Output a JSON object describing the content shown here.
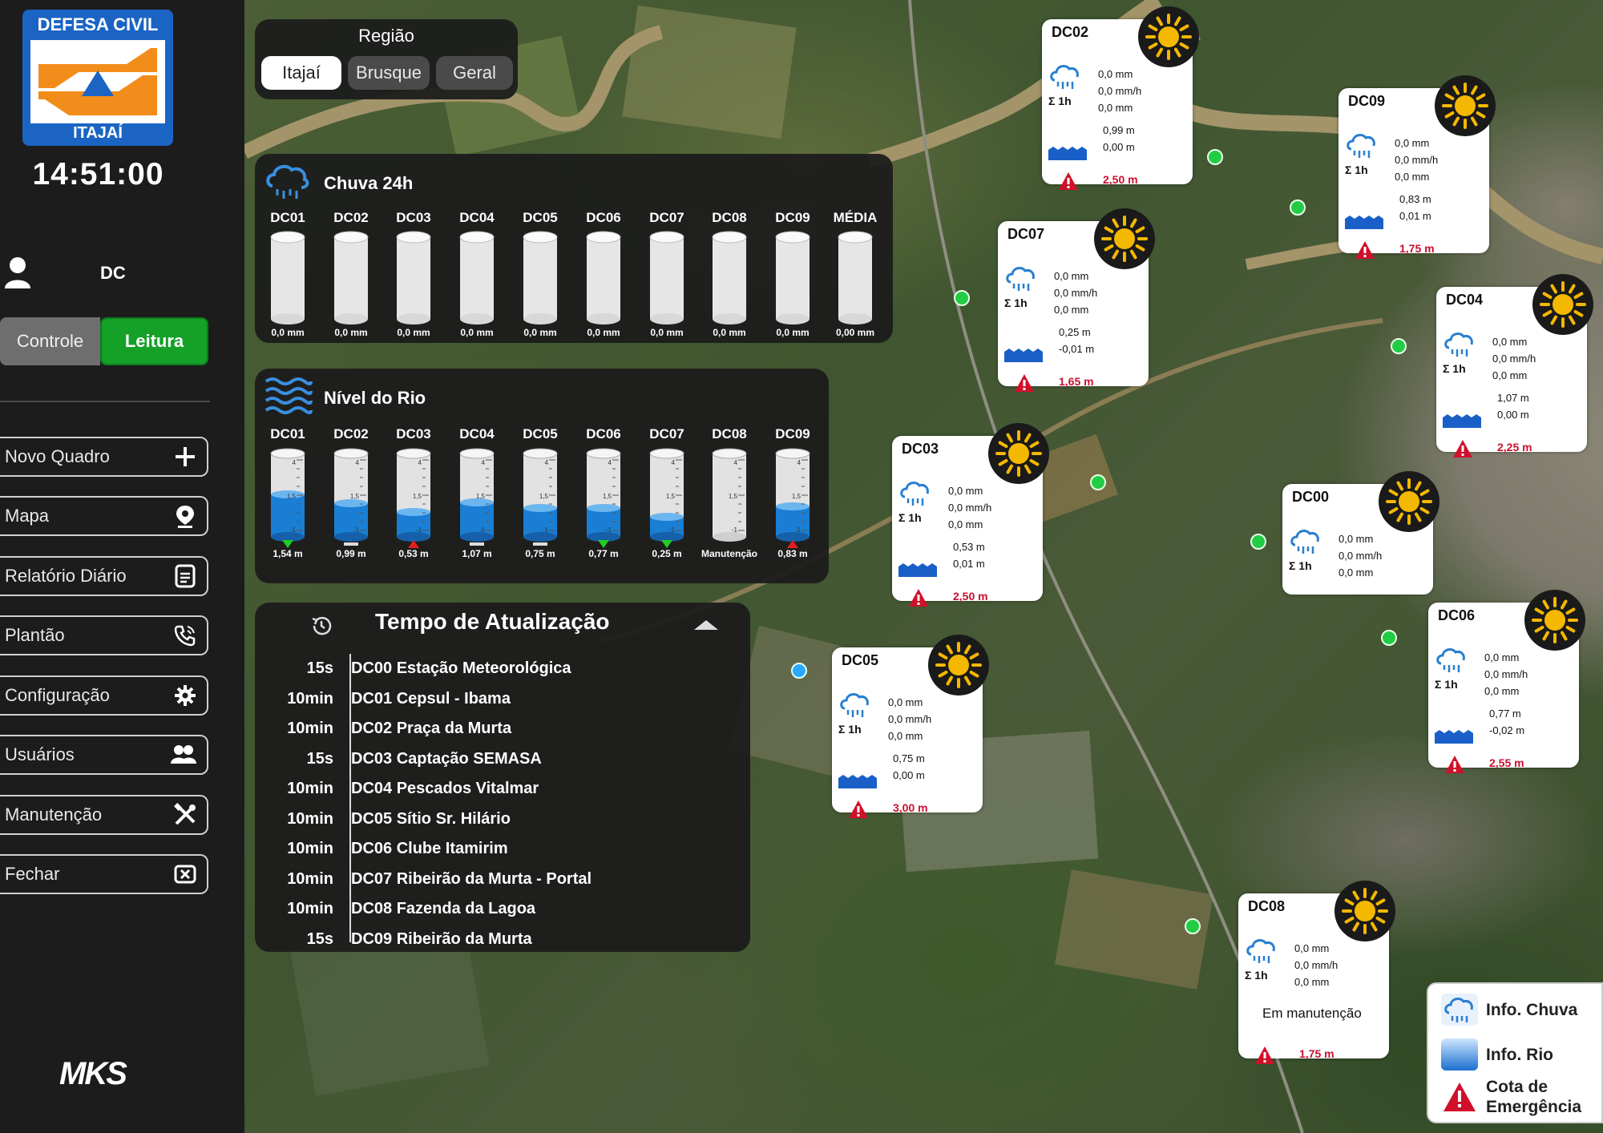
{
  "sidebar": {
    "logo_top": "DEFESA CIVIL",
    "logo_bottom": "ITAJAÍ",
    "clock": "14:51:00",
    "user": "DC",
    "mode": {
      "control": "Controle",
      "read": "Leitura"
    },
    "menu": [
      {
        "label": "Novo Quadro",
        "icon": "plus-icon"
      },
      {
        "label": "Mapa",
        "icon": "map-pin-icon"
      },
      {
        "label": "Relatório Diário",
        "icon": "report-icon"
      },
      {
        "label": "Plantão",
        "icon": "phone-icon"
      },
      {
        "label": "Configuração",
        "icon": "gear-icon"
      },
      {
        "label": "Usuários",
        "icon": "users-icon"
      },
      {
        "label": "Manutenção",
        "icon": "tools-icon"
      },
      {
        "label": "Fechar",
        "icon": "close-box-icon"
      }
    ],
    "brand": "MKS"
  },
  "region": {
    "title": "Região",
    "options": [
      "Itajaí",
      "Brusque",
      "Geral"
    ],
    "selected": "Itajaí"
  },
  "rain24h": {
    "title": "Chuva 24h",
    "stations": [
      "DC01",
      "DC02",
      "DC03",
      "DC04",
      "DC05",
      "DC06",
      "DC07",
      "DC08",
      "DC09",
      "MÉDIA"
    ],
    "values": [
      "0,0 mm",
      "0,0 mm",
      "0,0 mm",
      "0,0 mm",
      "0,0 mm",
      "0,0 mm",
      "0,0 mm",
      "0,0 mm",
      "0,0 mm",
      "0,00 mm"
    ],
    "fill": [
      0,
      0,
      0,
      0,
      0,
      0,
      0,
      0,
      0,
      0
    ]
  },
  "river": {
    "title": "Nível do Rio",
    "gauge_ticks": [
      "4",
      "1,5",
      "-1"
    ],
    "stations": [
      "DC01",
      "DC02",
      "DC03",
      "DC04",
      "DC05",
      "DC06",
      "DC07",
      "DC08",
      "DC09"
    ],
    "values": [
      "1,54 m",
      "0,99 m",
      "0,53 m",
      "1,07 m",
      "0,75 m",
      "0,77 m",
      "0,25 m",
      "Manutenção",
      "0,83 m"
    ],
    "trend": [
      "down",
      "flat",
      "up",
      "flat",
      "flat",
      "down",
      "down",
      "none",
      "up"
    ],
    "trend_colors": {
      "down": "#22cc22",
      "flat": "#dddddd",
      "up": "#e02020"
    },
    "level_fraction": [
      0.51,
      0.4,
      0.3,
      0.41,
      0.35,
      0.35,
      0.24,
      0,
      0.37
    ]
  },
  "update_times": {
    "title": "Tempo de Atualização",
    "rows": [
      {
        "t": "15s",
        "name": "DC00 Estação Meteorológica"
      },
      {
        "t": "10min",
        "name": "DC01 Cepsul - Ibama"
      },
      {
        "t": "10min",
        "name": "DC02 Praça da Murta"
      },
      {
        "t": "15s",
        "name": "DC03 Captação SEMASA"
      },
      {
        "t": "10min",
        "name": "DC04 Pescados Vitalmar"
      },
      {
        "t": "10min",
        "name": "DC05 Sítio Sr. Hilário"
      },
      {
        "t": "10min",
        "name": "DC06 Clube Itamirim"
      },
      {
        "t": "10min",
        "name": "DC07 Ribeirão da Murta - Portal"
      },
      {
        "t": "10min",
        "name": "DC08 Fazenda da Lagoa"
      },
      {
        "t": "15s",
        "name": "DC09 Ribeirão da Murta"
      }
    ]
  },
  "cards": {
    "sum_label": "Σ 1h",
    "items": [
      {
        "id": "DC02",
        "rain": [
          "0,0 mm",
          "0,0 mm/h",
          "0,0 mm"
        ],
        "level": [
          "0,99 m",
          "0,00 m"
        ],
        "emergency": "2,50 m"
      },
      {
        "id": "DC09",
        "rain": [
          "0,0 mm",
          "0,0 mm/h",
          "0,0 mm"
        ],
        "level": [
          "0,83 m",
          "0,01 m"
        ],
        "emergency": "1,75 m"
      },
      {
        "id": "DC07",
        "rain": [
          "0,0 mm",
          "0,0 mm/h",
          "0,0 mm"
        ],
        "level": [
          "0,25 m",
          "-0,01 m"
        ],
        "emergency": "1,65 m"
      },
      {
        "id": "DC04",
        "rain": [
          "0,0 mm",
          "0,0 mm/h",
          "0,0 mm"
        ],
        "level": [
          "1,07 m",
          "0,00 m"
        ],
        "emergency": "2,25 m"
      },
      {
        "id": "DC03",
        "rain": [
          "0,0 mm",
          "0,0 mm/h",
          "0,0 mm"
        ],
        "level": [
          "0,53 m",
          "0,01 m"
        ],
        "emergency": "2,50 m"
      },
      {
        "id": "DC00",
        "rain": [
          "0,0 mm",
          "0,0 mm/h",
          "0,0 mm"
        ]
      },
      {
        "id": "DC06",
        "rain": [
          "0,0 mm",
          "0,0 mm/h",
          "0,0 mm"
        ],
        "level": [
          "0,77 m",
          "-0,02 m"
        ],
        "emergency": "2,55 m"
      },
      {
        "id": "DC05",
        "rain": [
          "0,0 mm",
          "0,0 mm/h",
          "0,0 mm"
        ],
        "level": [
          "0,75 m",
          "0,00 m"
        ],
        "emergency": "3,00 m"
      },
      {
        "id": "DC08",
        "rain": [
          "0,0 mm",
          "0,0 mm/h",
          "0,0 mm"
        ],
        "status": "Em manutenção",
        "emergency": "1,75 m"
      }
    ]
  },
  "legend": {
    "rain": "Info. Chuva",
    "river": "Info. Rio",
    "emergency_line1": "Cota de",
    "emergency_line2": "Emergência"
  },
  "colors": {
    "accent_green": "#15a028",
    "water_blue": "#1a7fd4",
    "alert_red": "#c8102e",
    "sun_yellow": "#f5b800"
  }
}
